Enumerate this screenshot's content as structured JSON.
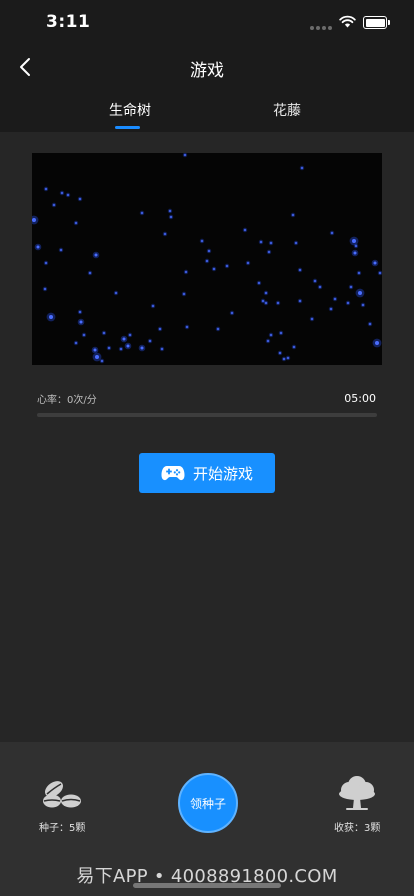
{
  "status_bar": {
    "time": "3:11"
  },
  "nav": {
    "title": "游戏"
  },
  "tabs": [
    {
      "label": "生命树",
      "active": true
    },
    {
      "label": "花藤",
      "active": false
    }
  ],
  "game": {
    "heart_rate_label": "心率：",
    "heart_rate_value": "0次/分",
    "timer": "05:00",
    "progress": 0,
    "start_label": "开始游戏"
  },
  "bottom": {
    "seeds_label": "种子：5颗",
    "claim_label": "领种子",
    "harvest_label": "收获：3颗",
    "watermark": "易下APP • 4008891800.COM"
  },
  "colors": {
    "accent": "#1890ff",
    "particle": "#2a55ff",
    "background": "#1b1b1b"
  }
}
